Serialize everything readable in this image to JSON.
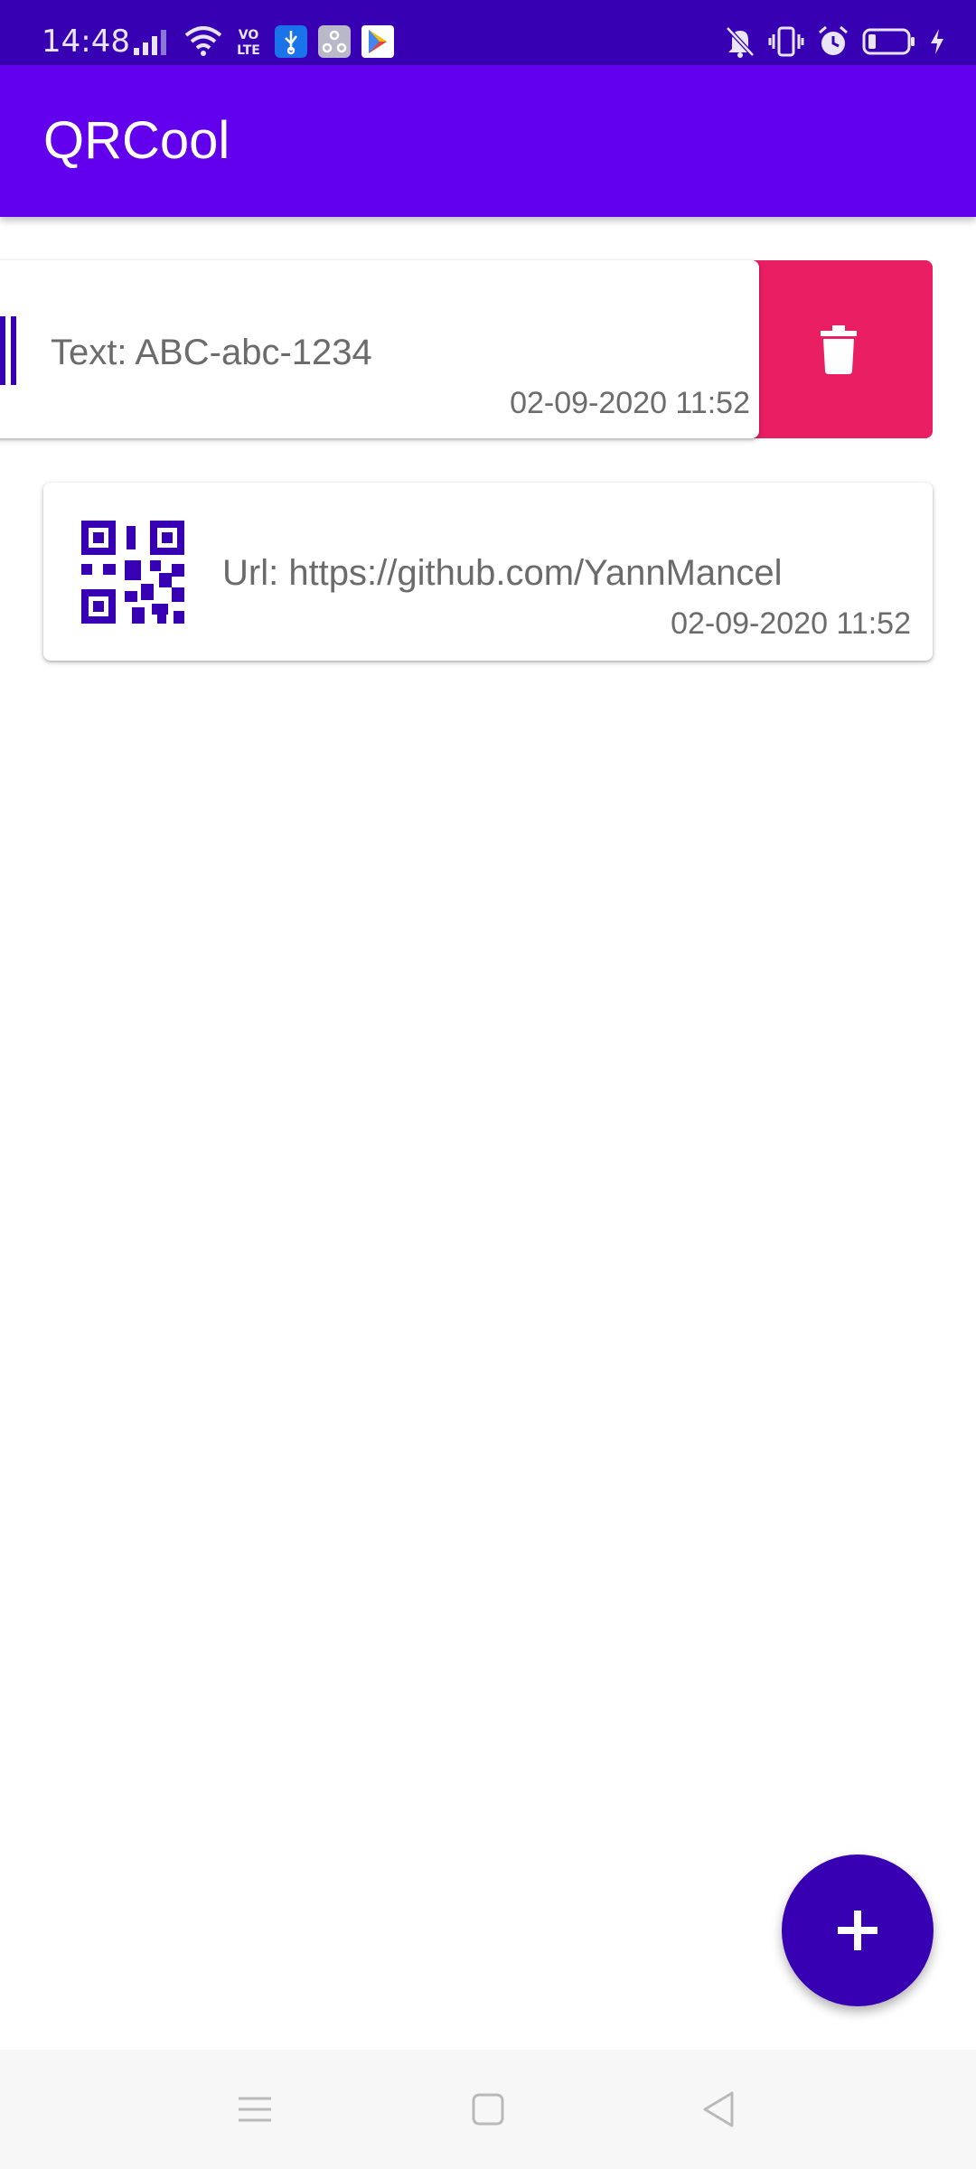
{
  "status_bar": {
    "time": "14:48",
    "background": "#3700B3",
    "left_icons": [
      "signal-icon",
      "wifi-icon",
      "volte-icon",
      "usb-icon",
      "app-notification-icon",
      "play-store-icon"
    ],
    "right_icons": [
      "mute-icon",
      "vibrate-icon",
      "alarm-icon",
      "battery-icon",
      "charging-icon"
    ]
  },
  "app_bar": {
    "title": "QRCool",
    "background": "#6200EE"
  },
  "items": [
    {
      "content": "Text: ABC-abc-1234",
      "date": "02-09-2020 11:52",
      "icon": "barcode-icon",
      "swiped": true
    },
    {
      "content": "Url: https://github.com/YannMancel",
      "date": "02-09-2020 11:52",
      "icon": "qr-code-icon",
      "swiped": false
    }
  ],
  "swipe_action": {
    "icon": "trash-icon",
    "color": "#E91E63"
  },
  "fab": {
    "icon": "plus-icon",
    "color": "#3700B3"
  },
  "nav_bar": {
    "icons": [
      "menu-icon",
      "home-icon",
      "back-icon"
    ]
  }
}
